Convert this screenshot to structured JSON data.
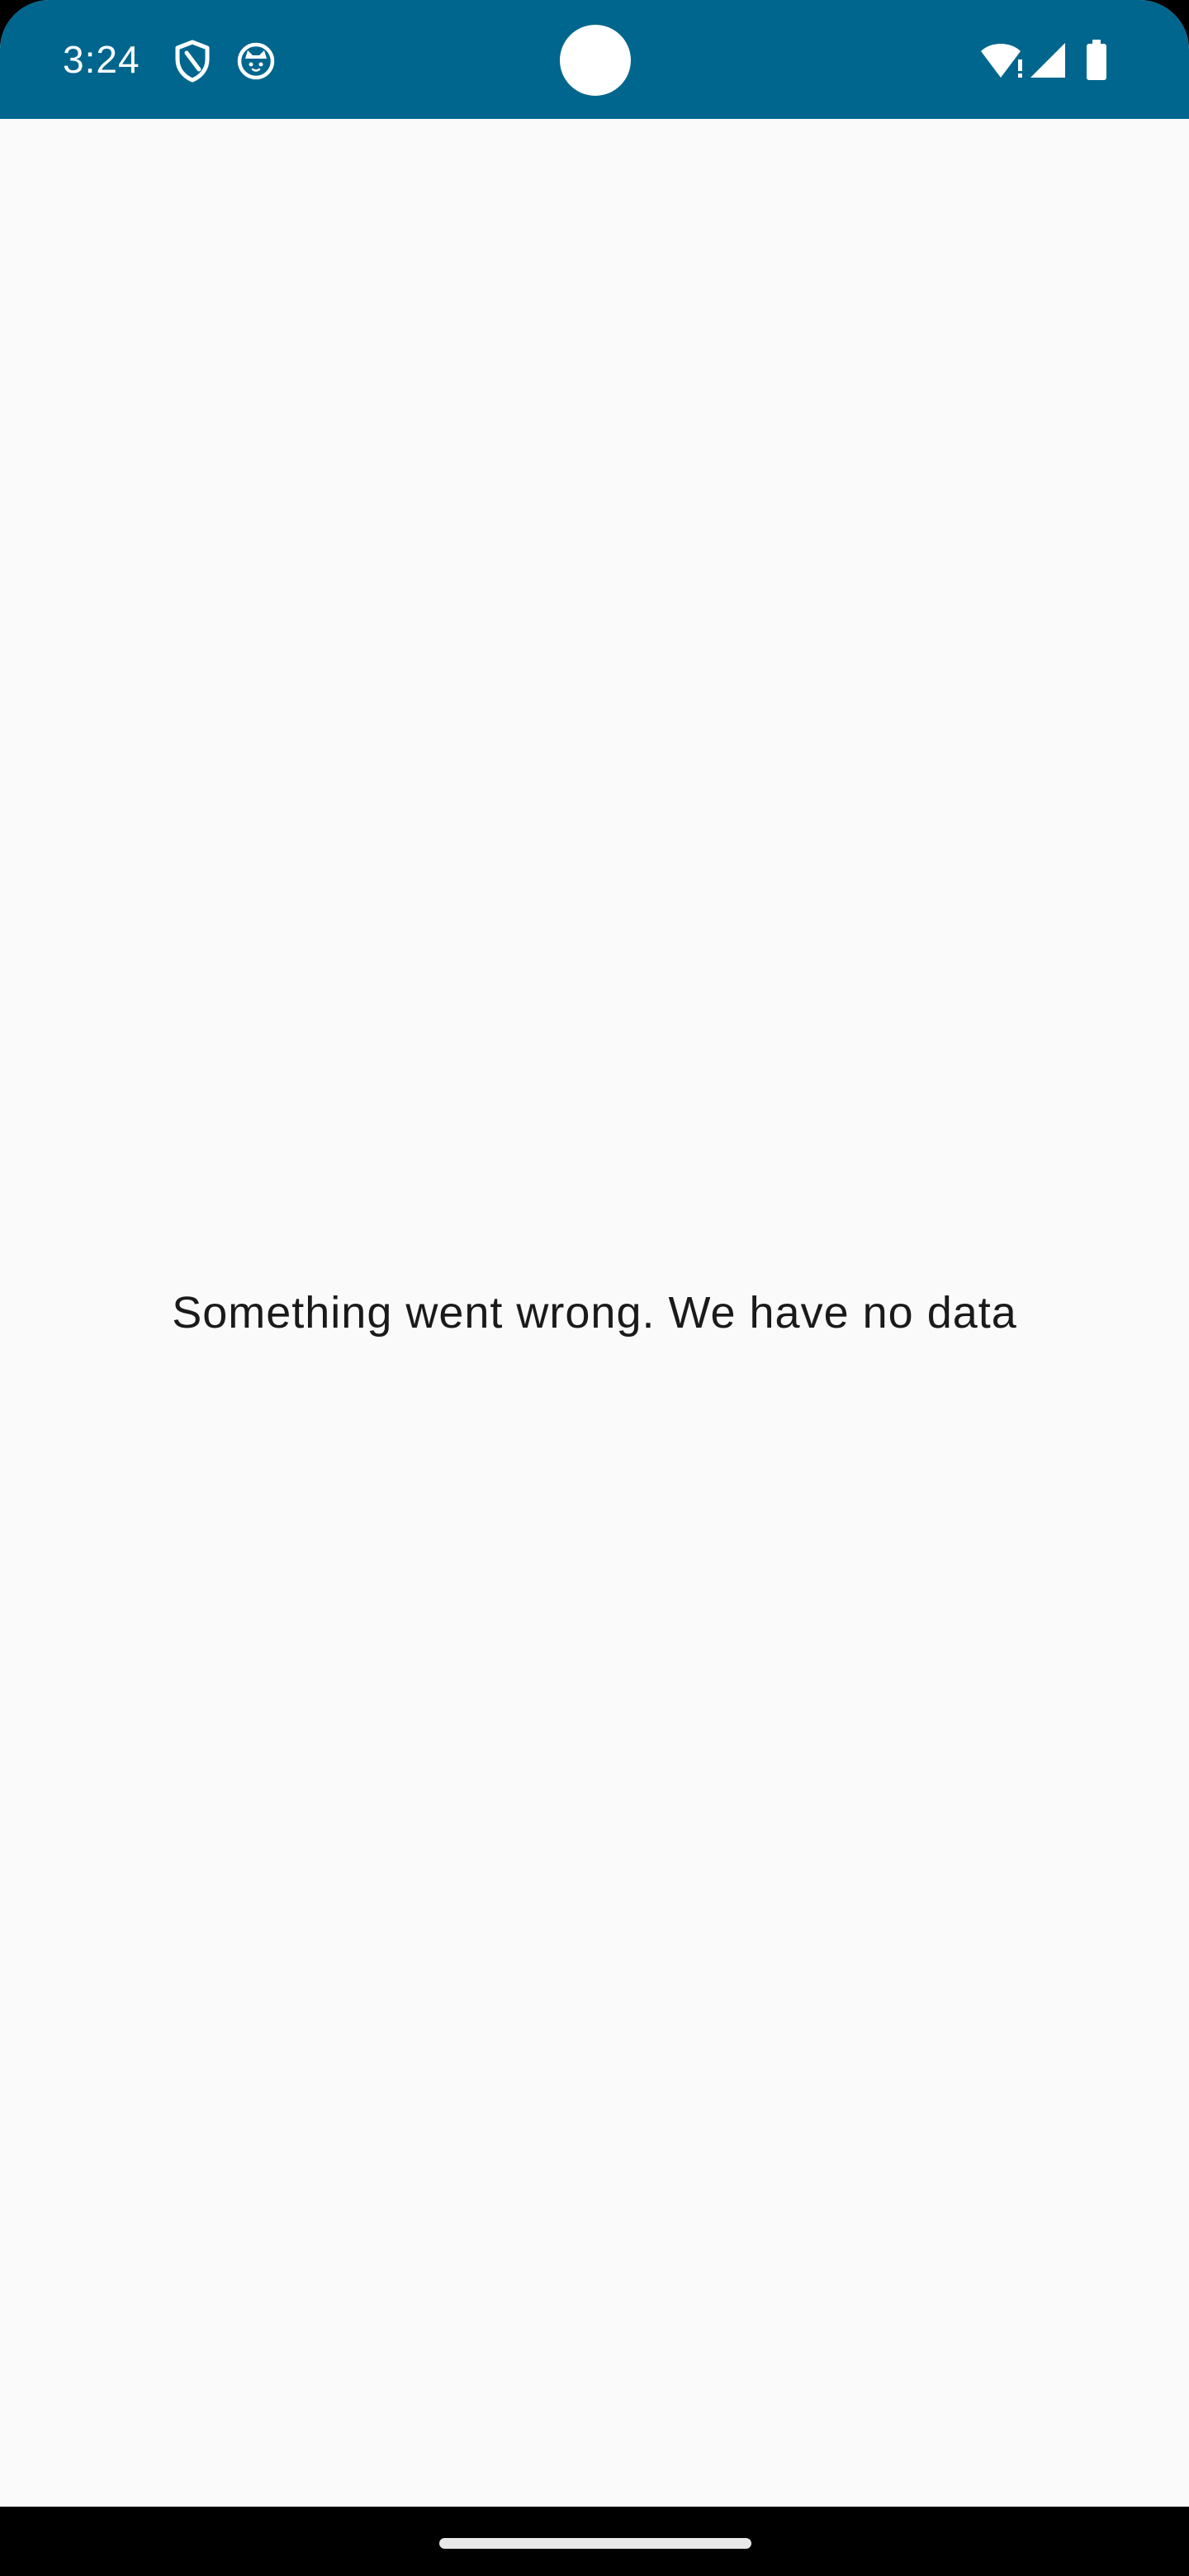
{
  "status_bar": {
    "time": "3:24",
    "background_color": "#00668D",
    "icons": [
      "shield-icon",
      "cat-face-icon",
      "wifi-alert-icon",
      "signal-icon",
      "battery-icon"
    ]
  },
  "main": {
    "message": "Something went wrong. We have no data",
    "background_color": "#FAFAFA"
  },
  "navigation_bar": {
    "background_color": "#000000",
    "handle": "home-gesture-handle"
  }
}
